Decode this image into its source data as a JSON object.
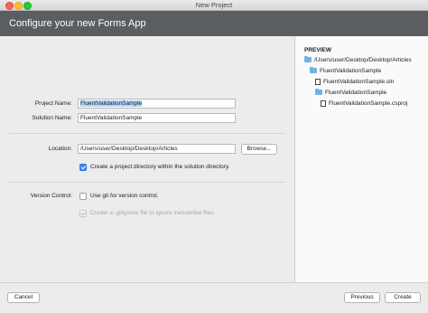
{
  "window": {
    "title": "New Project"
  },
  "header": {
    "title": "Configure your new Forms App"
  },
  "form": {
    "project_name_label": "Project Name:",
    "project_name_value": "FluentValidationSample",
    "solution_name_label": "Solution Name:",
    "solution_name_value": "FluentValidationSample",
    "location_label": "Location:",
    "location_value": "/Users/user/Desktop/Desktop/Articles",
    "browse_label": "Browse...",
    "create_dir_label": "Create a project directory within the solution directory.",
    "create_dir_checked": true,
    "version_control_label": "Version Control:",
    "use_git_label": "Use git for version control.",
    "use_git_checked": false,
    "gitignore_label": "Create a .gitignore file to ignore inessential files.",
    "gitignore_checked": true,
    "gitignore_enabled": false
  },
  "preview": {
    "title": "PREVIEW",
    "items": [
      {
        "type": "folder",
        "label": "/Users/user/Desktop/Desktop/Articles"
      },
      {
        "type": "folder",
        "label": "FluentValidationSample"
      },
      {
        "type": "file",
        "label": "FluentValidationSample.sln"
      },
      {
        "type": "folder",
        "label": "FluentValidationSample"
      },
      {
        "type": "file",
        "label": "FluentValidationSample.csproj"
      }
    ]
  },
  "footer": {
    "cancel_label": "Cancel",
    "previous_label": "Previous",
    "create_label": "Create"
  },
  "colors": {
    "header_bg": "#5a5d62",
    "accent": "#3b88f5",
    "selection": "#b3d4fd",
    "folder": "#6fb4e6"
  }
}
